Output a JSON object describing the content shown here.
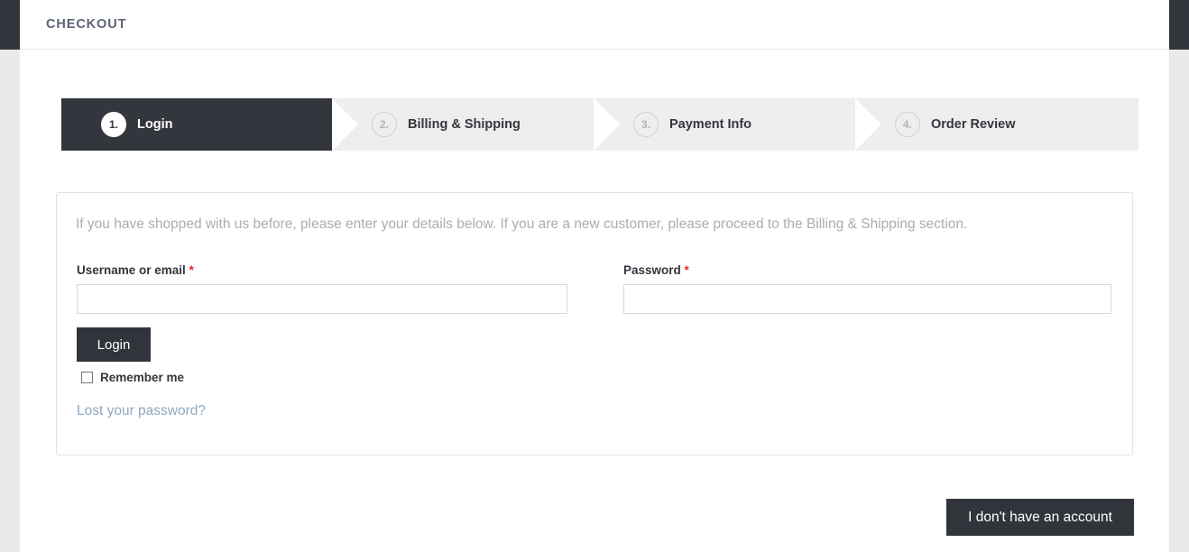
{
  "chrome": {
    "accent_dark": "#33363c",
    "rail_gray": "#e9e9e9"
  },
  "header": {
    "title": "CHECKOUT"
  },
  "steps": [
    {
      "number": "1.",
      "label": "Login",
      "state": "active"
    },
    {
      "number": "2.",
      "label": "Billing & Shipping",
      "state": "inactive"
    },
    {
      "number": "3.",
      "label": "Payment Info",
      "state": "inactive"
    },
    {
      "number": "4.",
      "label": "Order Review",
      "state": "inactive"
    }
  ],
  "login_card": {
    "intro": "If you have shopped with us before, please enter your details below. If you are a new customer, please proceed to the Billing & Shipping section.",
    "username": {
      "label": "Username or email",
      "required_marker": "*",
      "value": "",
      "placeholder": ""
    },
    "password": {
      "label": "Password",
      "required_marker": "*",
      "value": "",
      "placeholder": ""
    },
    "login_button": "Login",
    "remember_me": "Remember me",
    "remember_me_checked": false,
    "lost_password": "Lost your password?",
    "link_color": "#8fa8bf",
    "required_color": "#e02b2b"
  },
  "footer": {
    "no_account_button": "I don't have an account"
  }
}
